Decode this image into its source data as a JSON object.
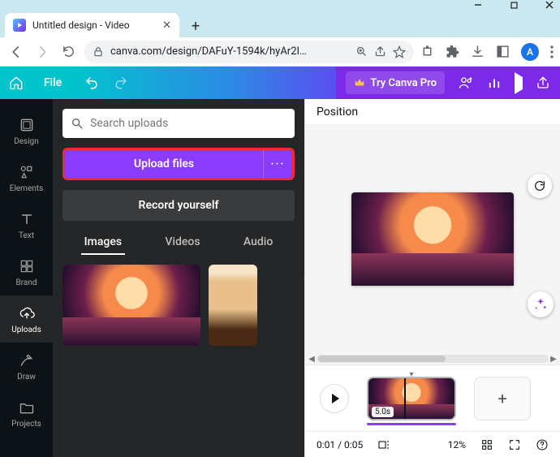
{
  "browser": {
    "tab_title": "Untitled design - Video",
    "url": "canva.com/design/DAFuY-1594k/hyAr2I…",
    "avatar_initial": "A"
  },
  "appbar": {
    "file_label": "File",
    "try_pro_label": "Try Canva Pro"
  },
  "rail": {
    "items": [
      {
        "label": "Design"
      },
      {
        "label": "Elements"
      },
      {
        "label": "Text"
      },
      {
        "label": "Brand"
      },
      {
        "label": "Uploads"
      },
      {
        "label": "Draw"
      },
      {
        "label": "Projects"
      }
    ],
    "active_index": 4
  },
  "panel": {
    "search_placeholder": "Search uploads",
    "upload_label": "Upload files",
    "record_label": "Record yourself",
    "tabs": [
      {
        "label": "Images"
      },
      {
        "label": "Videos"
      },
      {
        "label": "Audio"
      }
    ],
    "active_tab": 0
  },
  "stage": {
    "position_label": "Position"
  },
  "timeline": {
    "clip_duration": "5.0s"
  },
  "status": {
    "time": "0:01 / 0:05",
    "zoom": "12%"
  }
}
